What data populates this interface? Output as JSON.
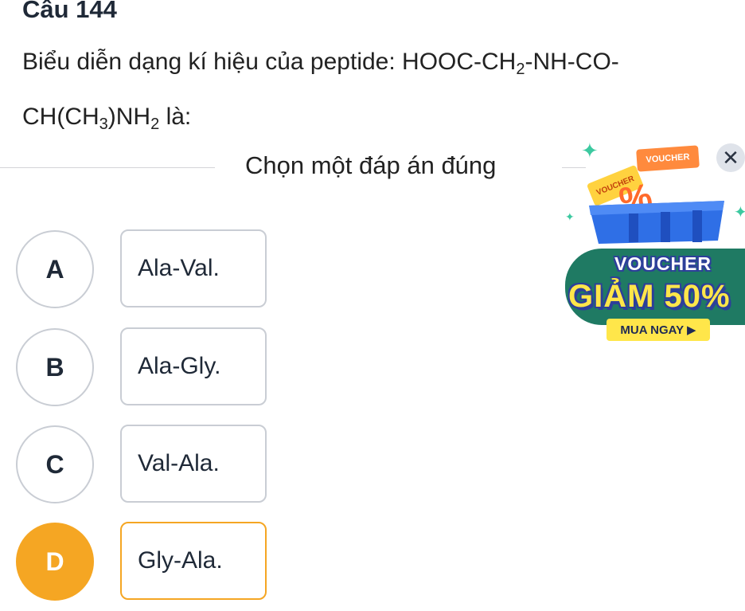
{
  "question": {
    "title": "Câu 144",
    "text_line1_prefix": "Biểu diễn dạng kí hiệu của peptide: HOOC-CH",
    "sub_2a": "2",
    "text_line1_suffix": "-NH-CO-",
    "text_line2_prefix": "CH(CH",
    "sub_3": "3",
    "text_line2_mid": ")NH",
    "sub_2b": "2",
    "text_line2_suffix": " là:"
  },
  "instruction": "Chọn một đáp án đúng",
  "options": [
    {
      "letter": "A",
      "label": "Ala-Val.",
      "selected": false
    },
    {
      "letter": "B",
      "label": "Ala-Gly.",
      "selected": false
    },
    {
      "letter": "C",
      "label": "Val-Ala.",
      "selected": false
    },
    {
      "letter": "D",
      "label": "Gly-Ala.",
      "selected": true
    }
  ],
  "ad": {
    "tag1": "VOUCHER",
    "tag2": "VOUCHER",
    "percent": "%",
    "voucher": "VOUCHER",
    "discount": "GIẢM 50%",
    "buy": "MUA NGAY ▶",
    "close_icon": "close-icon"
  },
  "colors": {
    "selected": "#f5a623",
    "border": "#c9cdd4",
    "ad_green": "#1f7a63",
    "ad_yellow": "#ffe64a"
  }
}
